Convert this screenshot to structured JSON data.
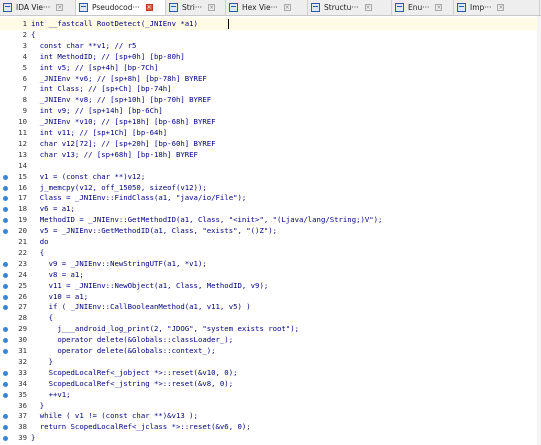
{
  "tabs": [
    {
      "label": "IDA Vie···",
      "icon": "ida-view-icon",
      "active": false
    },
    {
      "label": "Pseudocod···",
      "icon": "pseudocode-icon",
      "active": true
    },
    {
      "label": "Stri···",
      "icon": "strings-icon",
      "active": false
    },
    {
      "label": "Hex Vie···",
      "icon": "hex-view-icon",
      "active": false
    },
    {
      "label": "Structu···",
      "icon": "structures-icon",
      "active": false
    },
    {
      "label": "Enu···",
      "icon": "enums-icon",
      "active": false
    },
    {
      "label": "Imp···",
      "icon": "imports-icon",
      "active": false
    }
  ],
  "colors": {
    "code_text": "#000080",
    "breakpoint_dot": "#3a86d6",
    "active_tab_close": "#e2553a"
  },
  "code_lines": [
    {
      "num": "1",
      "text": "int __fastcall RootDetect(_JNIEnv *a1)",
      "dot": false
    },
    {
      "num": "2",
      "text": "{",
      "dot": false
    },
    {
      "num": "3",
      "text": "  const char **v1; // r5",
      "dot": false
    },
    {
      "num": "4",
      "text": "  int MethodID; // [sp+0h] [bp-80h]",
      "dot": false
    },
    {
      "num": "5",
      "text": "  int v5; // [sp+4h] [bp-7Ch]",
      "dot": false
    },
    {
      "num": "6",
      "text": "  _JNIEnv *v6; // [sp+8h] [bp-78h] BYREF",
      "dot": false
    },
    {
      "num": "7",
      "text": "  int Class; // [sp+Ch] [bp-74h]",
      "dot": false
    },
    {
      "num": "8",
      "text": "  _JNIEnv *v8; // [sp+10h] [bp-70h] BYREF",
      "dot": false
    },
    {
      "num": "9",
      "text": "  int v9; // [sp+14h] [bp-6Ch]",
      "dot": false
    },
    {
      "num": "10",
      "text": "  _JNIEnv *v10; // [sp+18h] [bp-68h] BYREF",
      "dot": false
    },
    {
      "num": "11",
      "text": "  int v11; // [sp+1Ch] [bp-64h]",
      "dot": false
    },
    {
      "num": "12",
      "text": "  char v12[72]; // [sp+20h] [bp-60h] BYREF",
      "dot": false
    },
    {
      "num": "13",
      "text": "  char v13; // [sp+68h] [bp-18h] BYREF",
      "dot": false
    },
    {
      "num": "14",
      "text": "",
      "dot": false
    },
    {
      "num": "15",
      "text": "  v1 = (const char **)v12;",
      "dot": true
    },
    {
      "num": "16",
      "text": "  j_memcpy(v12, off_15050, sizeof(v12));",
      "dot": true
    },
    {
      "num": "17",
      "text": "  Class = _JNIEnv::FindClass(a1, \"java/io/File\");",
      "dot": true
    },
    {
      "num": "18",
      "text": "  v6 = a1;",
      "dot": true
    },
    {
      "num": "19",
      "text": "  MethodID = _JNIEnv::GetMethodID(a1, Class, \"<init>\", \"(Ljava/lang/String;)V\");",
      "dot": true
    },
    {
      "num": "20",
      "text": "  v5 = _JNIEnv::GetMethodID(a1, Class, \"exists\", \"()Z\");",
      "dot": true
    },
    {
      "num": "21",
      "text": "  do",
      "dot": false
    },
    {
      "num": "22",
      "text": "  {",
      "dot": false
    },
    {
      "num": "23",
      "text": "    v9 = _JNIEnv::NewStringUTF(a1, *v1);",
      "dot": true
    },
    {
      "num": "24",
      "text": "    v8 = a1;",
      "dot": true
    },
    {
      "num": "25",
      "text": "    v11 = _JNIEnv::NewObject(a1, Class, MethodID, v9);",
      "dot": true
    },
    {
      "num": "26",
      "text": "    v10 = a1;",
      "dot": true
    },
    {
      "num": "27",
      "text": "    if ( _JNIEnv::CallBooleanMethod(a1, v11, v5) )",
      "dot": true
    },
    {
      "num": "28",
      "text": "    {",
      "dot": false
    },
    {
      "num": "29",
      "text": "      j___android_log_print(2, \"JDOG\", \"system exists root\");",
      "dot": true
    },
    {
      "num": "30",
      "text": "      operator delete(&Globals::classLoader_);",
      "dot": true
    },
    {
      "num": "31",
      "text": "      operator delete(&Globals::context_);",
      "dot": true
    },
    {
      "num": "32",
      "text": "    }",
      "dot": false
    },
    {
      "num": "33",
      "text": "    ScopedLocalRef<_jobject *>::reset(&v10, 0);",
      "dot": true
    },
    {
      "num": "34",
      "text": "    ScopedLocalRef<_jstring *>::reset(&v8, 0);",
      "dot": true
    },
    {
      "num": "35",
      "text": "    ++v1;",
      "dot": true
    },
    {
      "num": "36",
      "text": "  }",
      "dot": false
    },
    {
      "num": "37",
      "text": "  while ( v1 != (const char **)&v13 );",
      "dot": true
    },
    {
      "num": "38",
      "text": "  return ScopedLocalRef<_jclass *>::reset(&v6, 0);",
      "dot": true
    },
    {
      "num": "39",
      "text": "}",
      "dot": true
    }
  ]
}
